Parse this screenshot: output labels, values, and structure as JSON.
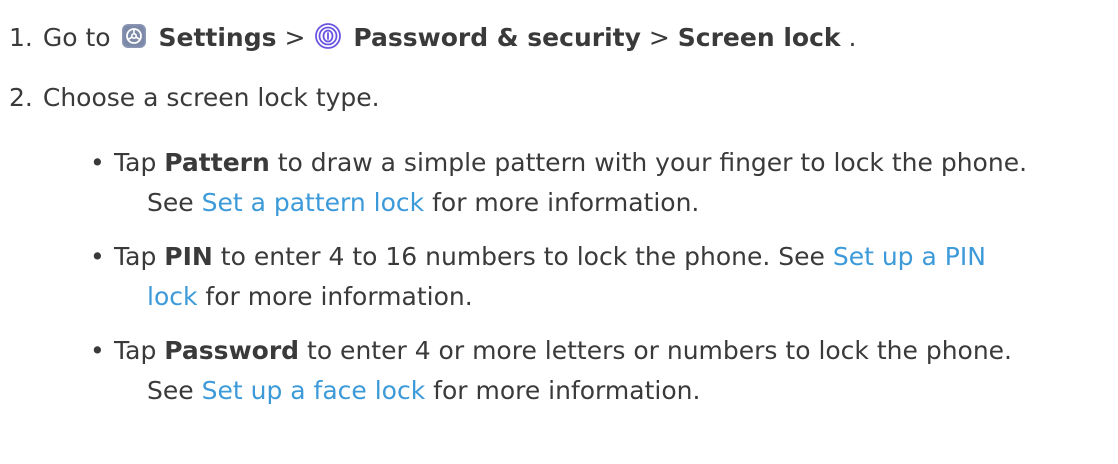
{
  "step1": {
    "number": "1.",
    "go_to": "Go to",
    "settings_icon": "settings-app-icon",
    "settings": "Settings",
    "sep1": ">",
    "password_icon": "fingerprint-app-icon",
    "password_security": "Password & security",
    "sep2": ">",
    "screen_lock": "Screen lock",
    "end": "."
  },
  "step2": {
    "number": "2.",
    "text": "Choose a screen lock type."
  },
  "bullets": [
    {
      "tap": "Tap",
      "bold": "Pattern",
      "rest": "to draw a simple pattern with your finger to lock the phone.",
      "see": "See",
      "link": "Set a pattern lock",
      "tail": "for more information."
    },
    {
      "tap": "Tap",
      "bold": "PIN",
      "rest": "to enter 4 to 16 numbers to lock the phone. See",
      "link_a": "Set up a PIN",
      "link_b": "lock",
      "tail": "for more information."
    },
    {
      "tap": "Tap",
      "bold": "Password",
      "rest": "to enter 4 or more letters or numbers to lock the phone.",
      "see": "See",
      "link": "Set up a face lock",
      "tail": "for more information."
    }
  ],
  "colors": {
    "text": "#3a3a3a",
    "link": "#3d9ad9",
    "settings_icon_bg": "#8a96b4",
    "fingerprint_icon": "#6a55e0"
  }
}
